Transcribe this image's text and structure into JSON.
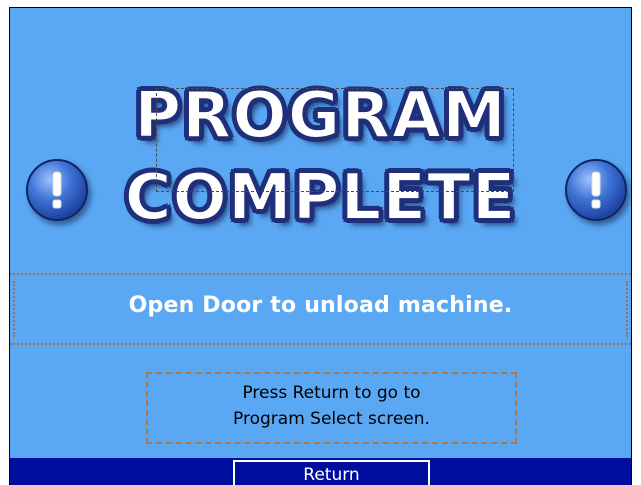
{
  "title": {
    "line1": "PROGRAM",
    "line2": "COMPLETE"
  },
  "icons": {
    "left": "exclamation-icon",
    "right": "exclamation-icon"
  },
  "message": "Open Door to unload machine.",
  "hint": {
    "line1": "Press Return to go to",
    "line2": "Program Select screen."
  },
  "buttons": {
    "return_label": "Return"
  },
  "colors": {
    "background": "#5aa8f4",
    "bottom_bar": "#000e9e",
    "title_outline": "#1f2f7a"
  }
}
